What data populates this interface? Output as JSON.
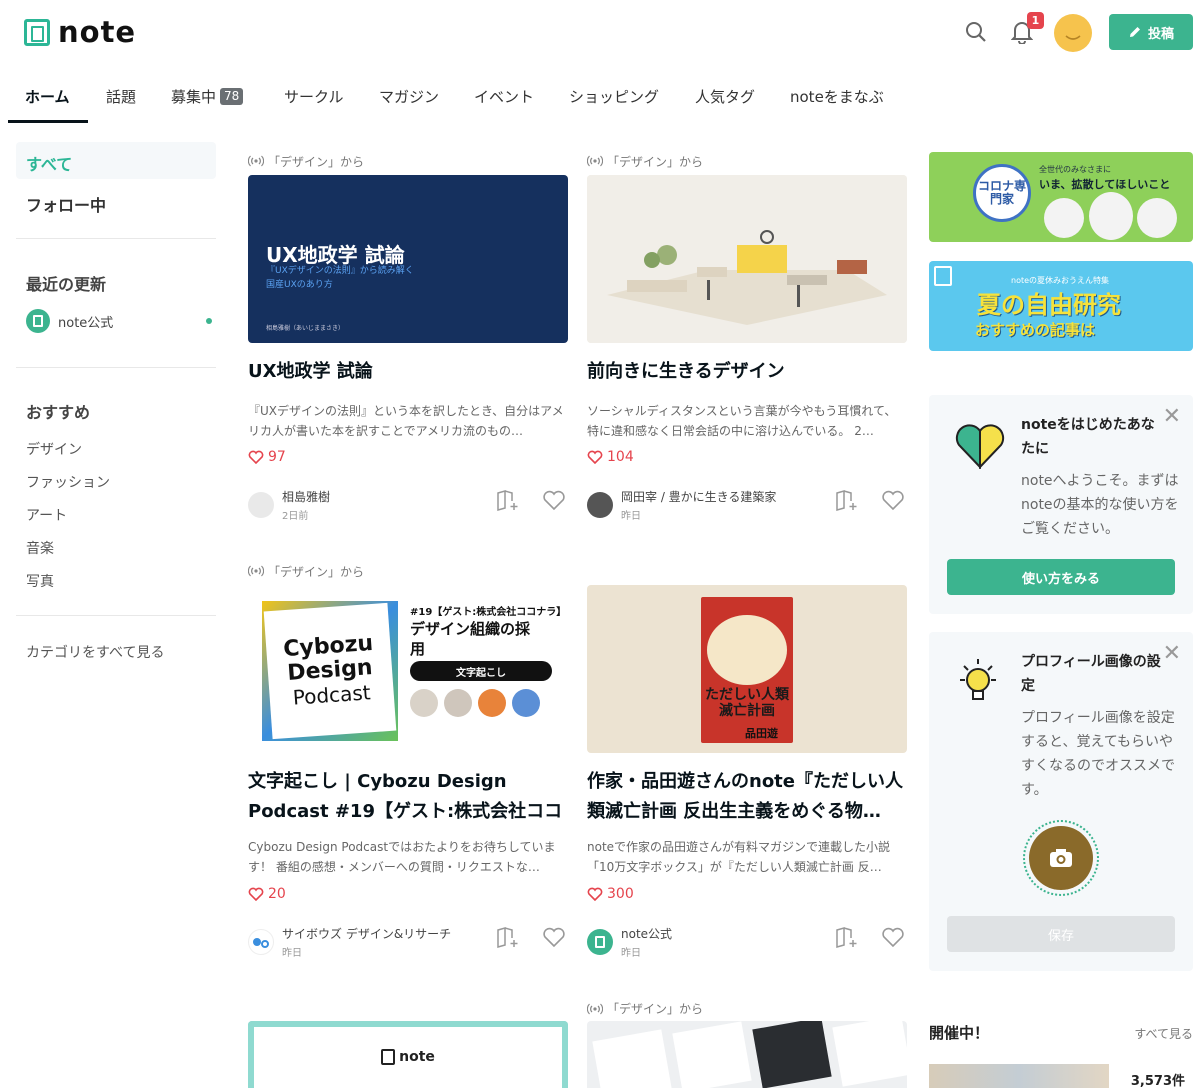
{
  "app": {
    "logo_text": "note"
  },
  "header": {
    "notification_count": "1",
    "post_label": "投稿",
    "icons": [
      "search-icon",
      "bell-icon",
      "pencil-icon"
    ]
  },
  "tabs": [
    {
      "label": "ホーム",
      "active": true
    },
    {
      "label": "話題"
    },
    {
      "label": "募集中",
      "count": "78"
    },
    {
      "label": "サークル"
    },
    {
      "label": "マガジン"
    },
    {
      "label": "イベント"
    },
    {
      "label": "ショッピング"
    },
    {
      "label": "人気タグ"
    },
    {
      "label": "noteをまなぶ"
    }
  ],
  "sidebar": {
    "all": "すべて",
    "following": "フォロー中",
    "recent_heading": "最近の更新",
    "recent_item": "note公式",
    "recommend_heading": "おすすめ",
    "categories": [
      "デザイン",
      "ファッション",
      "アート",
      "音楽",
      "写真"
    ],
    "see_all": "カテゴリをすべて見る"
  },
  "cards": [
    {
      "source": "「デザイン」から",
      "thumb_title": "UX地政学 試論",
      "thumb_subtitle": "『UXデザインの法則』から読み解く",
      "thumb_subtitle2": "国産UXのあり方",
      "thumb_author": "相島雅樹（あいじままさき）",
      "title": "UX地政学 試論",
      "excerpt": "『UXデザインの法則』という本を訳したとき、自分はアメリカ人が書いた本を訳すことでアメリカ流のもの…",
      "likes": "97",
      "author": "相島雅樹",
      "date": "2日前"
    },
    {
      "source": "「デザイン」から",
      "title": "前向きに生きるデザイン",
      "excerpt": "ソーシャルディスタンスという言葉が今やもう耳慣れて、特に違和感なく日常会話の中に溶け込んでいる。 2…",
      "likes": "104",
      "author": "岡田宰 / 豊かに生きる建築家",
      "date": "昨日"
    },
    {
      "source": "「デザイン」から",
      "thumb_lines": [
        "Cybozu",
        "Design",
        "Podcast"
      ],
      "thumb_episode": "#19【ゲスト:株式会社ココナラ】",
      "thumb_heading": "デザイン組織の採用",
      "thumb_pill": "文字起こし",
      "title": "文字起こし | Cybozu Design Podcast #19【ゲスト:株式会社ココナ…",
      "excerpt": "Cybozu Design Podcastではおたよりをお待ちしています！ 番組の感想・メンバーへの質問・リクエストな…",
      "likes": "20",
      "author": "サイボウズ デザイン&リサーチ",
      "date": "昨日"
    },
    {
      "source": "",
      "thumb_book_title": "ただしい人類滅亡計画",
      "thumb_book_author": "品田遊",
      "title": "作家・品田遊さんのnote『ただしい人類滅亡計画 反出生主義をめぐる物…",
      "excerpt": "noteで作家の品田遊さんが有料マガジンで連載した小説「10万文字ボックス」が『ただしい人類滅亡計画 反…",
      "likes": "300",
      "author": "note公式",
      "date": "昨日"
    },
    {
      "source": "",
      "thumb_text": "note"
    },
    {
      "source": "「デザイン」から"
    }
  ],
  "rail": {
    "banner1_title": "コロナ専門家",
    "banner1_text": "全世代のみなさまに",
    "banner1_text2": "いま、拡散してほしいこと",
    "banner2_small": "noteの夏休みおうえん特集",
    "banner2_big": "夏の自由研究",
    "banner2_sub": "おすすめの記事は",
    "welcome_title": "noteをはじめたあなたに",
    "welcome_body": "noteへようこそ。まずはnoteの基本的な使い方をご覧ください。",
    "welcome_button": "使い方をみる",
    "profile_title": "プロフィール画像の設定",
    "profile_body": "プロフィール画像を設定すると、覚えてもらいやすくなるのでオススメです。",
    "save_button": "保存",
    "events_heading": "開催中！",
    "events_see_all": "すべて見る",
    "events_count": "3,573件"
  },
  "colors": {
    "accent": "#3cb48f",
    "like": "#e5444d"
  }
}
